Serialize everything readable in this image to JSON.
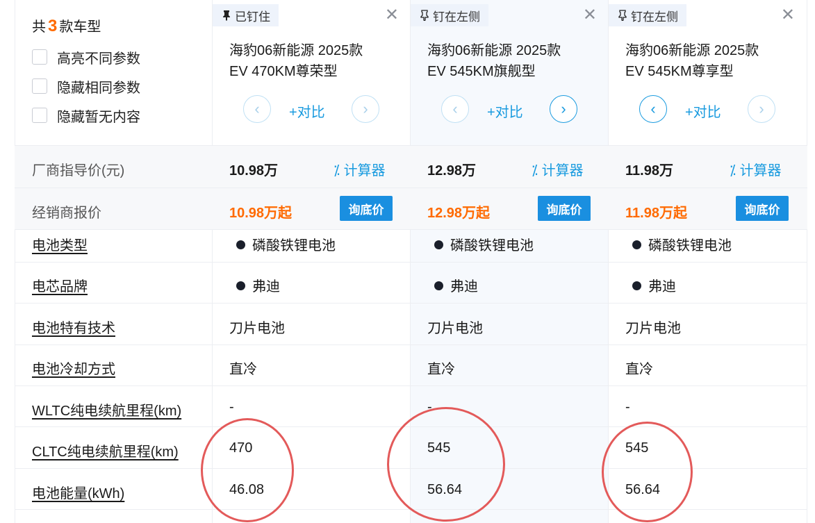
{
  "summary": {
    "prefix": "共",
    "count": "3",
    "suffix": "款车型"
  },
  "options": [
    "高亮不同参数",
    "隐藏相同参数",
    "隐藏暂无内容"
  ],
  "cars": [
    {
      "pin_label": "已钉住",
      "name_line1": "海豹06新能源 2025款",
      "name_line2": "EV 470KM尊荣型",
      "compare_label": "+对比",
      "msrp": "10.98万",
      "dealer": "10.98万起",
      "battery_type": "磷酸铁锂电池",
      "cell_brand": "弗迪",
      "battery_tech": "刀片电池",
      "cooling": "直冷",
      "wltc": "-",
      "cltc": "470",
      "energy": "46.08"
    },
    {
      "pin_label": "钉在左侧",
      "name_line1": "海豹06新能源 2025款",
      "name_line2": "EV 545KM旗舰型",
      "compare_label": "+对比",
      "msrp": "12.98万",
      "dealer": "12.98万起",
      "battery_type": "磷酸铁锂电池",
      "cell_brand": "弗迪",
      "battery_tech": "刀片电池",
      "cooling": "直冷",
      "wltc": "-",
      "cltc": "545",
      "energy": "56.64"
    },
    {
      "pin_label": "钉在左侧",
      "name_line1": "海豹06新能源 2025款",
      "name_line2": "EV 545KM尊享型",
      "compare_label": "+对比",
      "msrp": "11.98万",
      "dealer": "11.98万起",
      "battery_type": "磷酸铁锂电池",
      "cell_brand": "弗迪",
      "battery_tech": "刀片电池",
      "cooling": "直冷",
      "wltc": "-",
      "cltc": "545",
      "energy": "56.64"
    }
  ],
  "labels": {
    "msrp": "厂商指导价(元)",
    "dealer": "经销商报价",
    "battery_type": "电池类型",
    "cell_brand": "电芯品牌",
    "battery_tech": "电池特有技术",
    "cooling": "电池冷却方式",
    "wltc": "WLTC纯电续航里程(km)",
    "cltc": "CLTC纯电续航里程(km)",
    "energy": "电池能量(kWh)"
  },
  "buttons": {
    "calculator": "计算器",
    "ask_price": "询底价"
  },
  "icons": {
    "close": "close-icon",
    "pin": "pin-icon",
    "prev": "chevron-left-icon",
    "next": "chevron-right-icon",
    "calc": "calculator-icon"
  },
  "colors": {
    "accent": "#1a9bdf",
    "price": "#ff6a00",
    "button": "#1a8fe0",
    "annotation": "#e35a5a"
  }
}
